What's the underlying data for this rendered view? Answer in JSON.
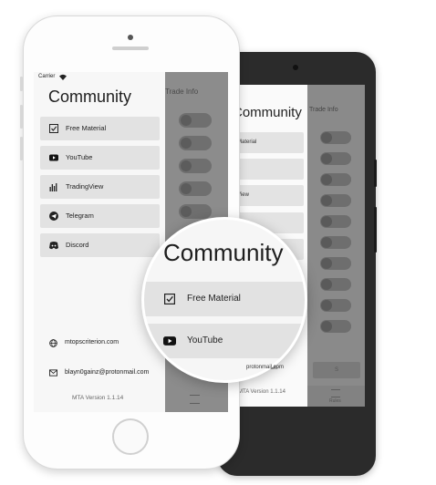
{
  "iphone": {
    "status": {
      "carrier": "Carrier",
      "wifi_icon": "wifi-icon",
      "battery_icon": "battery-icon"
    },
    "drawer": {
      "title": "Community",
      "items": [
        {
          "label": "Free Material",
          "icon": "checkbox-icon"
        },
        {
          "label": "YouTube",
          "icon": "youtube-icon"
        },
        {
          "label": "TradingView",
          "icon": "tradingview-icon"
        },
        {
          "label": "Telegram",
          "icon": "telegram-icon"
        },
        {
          "label": "Discord",
          "icon": "discord-icon"
        }
      ],
      "website": "mtopscriterion.com",
      "email": "blayn0gainz@protonmail.com",
      "version": "MTA Version 1.1.14"
    },
    "panel": {
      "title": "Trade Info"
    }
  },
  "android": {
    "drawer": {
      "title": "Community",
      "items": [
        {
          "label": "Material"
        },
        {
          "label": "e"
        },
        {
          "label": "View"
        },
        {
          "label": ""
        },
        {
          "label": ""
        }
      ],
      "email": "protonmail.com",
      "version": "MTA Version 1.1.14"
    },
    "panel": {
      "title": "Trade Info",
      "button_label": "S",
      "tab_label": "Rules"
    }
  },
  "magnifier": {
    "title": "Community",
    "items": [
      {
        "label": "Free Material",
        "icon": "checkbox-icon"
      },
      {
        "label": "YouTube",
        "icon": "youtube-icon"
      }
    ],
    "partial_email": "protonmail.com"
  },
  "colors": {
    "drawer_bg": "#f7f7f7",
    "item_bg": "#e2e2e2",
    "panel_bg": "#8c8c8c",
    "android_body": "#2b2b2b",
    "toggle": "#6f6f6f"
  }
}
